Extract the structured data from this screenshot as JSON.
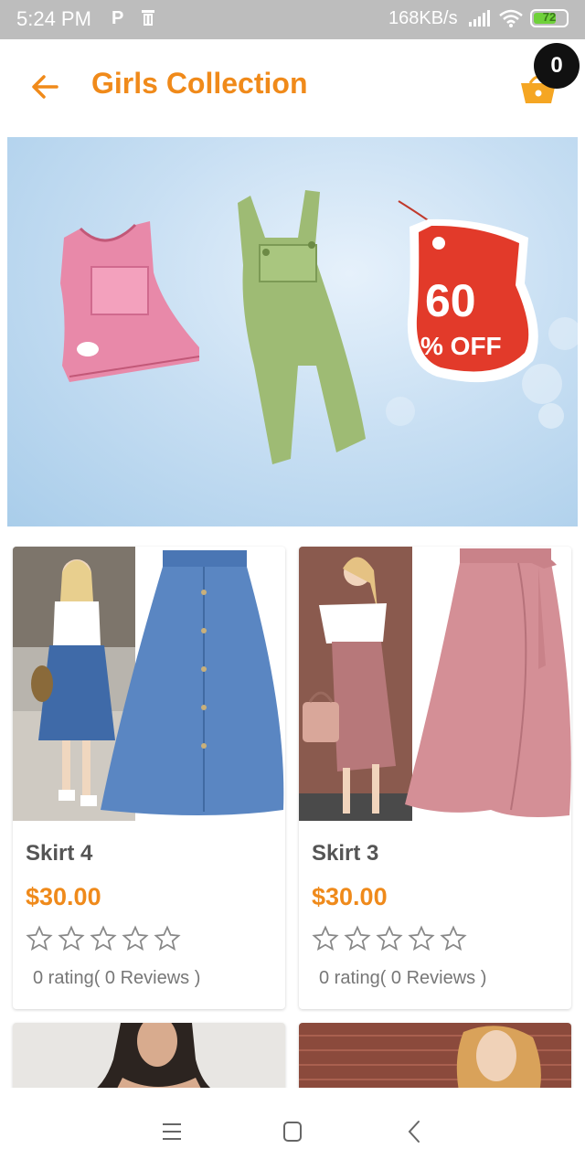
{
  "status_bar": {
    "time": "5:24 PM",
    "p_icon": "P",
    "speed": "168KB/s",
    "battery": "72",
    "battery_level": 0.72
  },
  "app_bar": {
    "title": "Girls Collection",
    "cart_count": "0",
    "accent_color": "#f08a1a",
    "back_icon": "arrow-left-icon",
    "cart_icon": "basket-icon"
  },
  "banner": {
    "discount_number": "60",
    "discount_label": "% OFF"
  },
  "products": [
    {
      "name": "Skirt 4",
      "price": "$30.00",
      "rating_stars": 0,
      "rating_text": "0 rating( 0 Reviews )"
    },
    {
      "name": "Skirt 3",
      "price": "$30.00",
      "rating_stars": 0,
      "rating_text": "0 rating( 0 Reviews )"
    }
  ],
  "nav_bar": {
    "icons": [
      "menu-icon",
      "home-square-icon",
      "back-chevron-icon"
    ]
  }
}
